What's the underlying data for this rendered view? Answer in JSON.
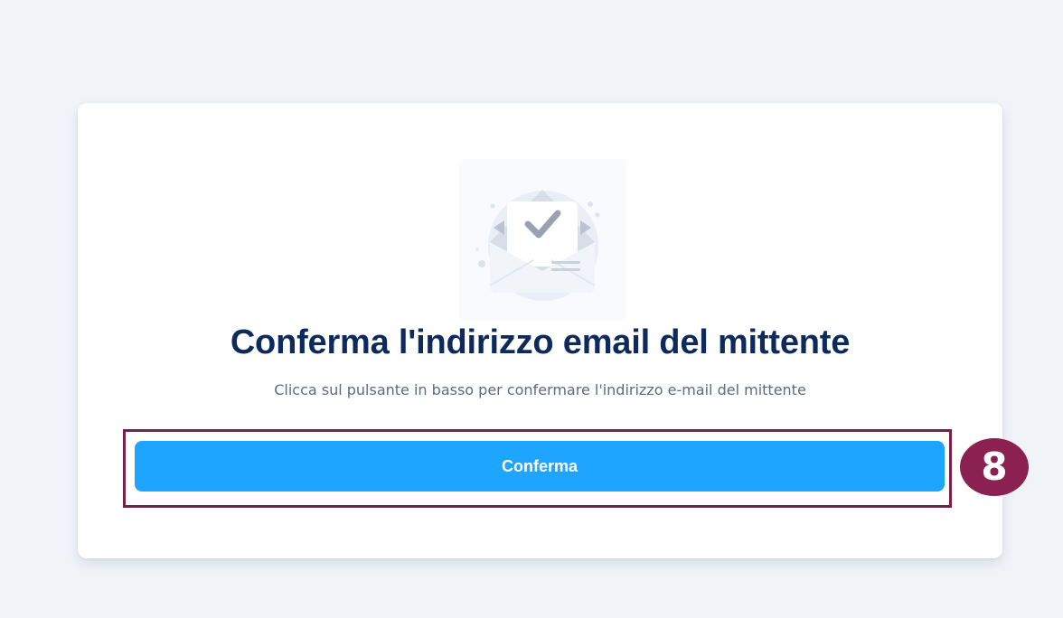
{
  "dialog": {
    "illustration_icon": "open-envelope-check-icon",
    "title": "Conferma l'indirizzo email del mittente",
    "subtitle": "Clicca sul pulsante in basso per confermare l'indirizzo e-mail del mittente",
    "confirm_label": "Conferma"
  },
  "annotation": {
    "step_number": "8"
  },
  "colors": {
    "page_background": "#f0f3f8",
    "card_background": "#ffffff",
    "title_text": "#0d2a5c",
    "subtitle_text": "#5b6b85",
    "button_accent": "#1ea5ff",
    "highlight_border": "#7a1f45",
    "badge_background": "#8b2150"
  }
}
